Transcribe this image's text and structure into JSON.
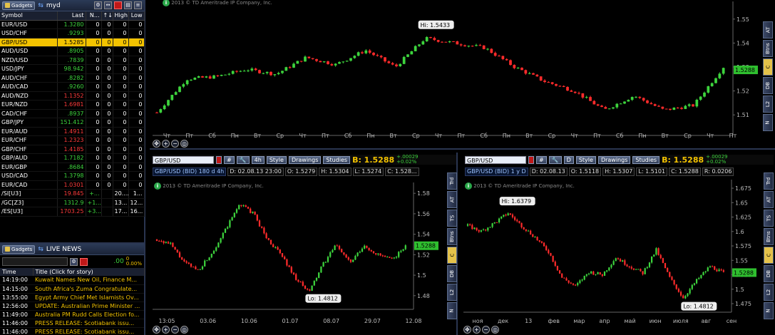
{
  "watchlist": {
    "gadget_label": "Gadgets",
    "name": "myd",
    "columns": [
      "Symbol",
      "Last",
      "N...",
      "↑↓",
      "High",
      "Low"
    ],
    "rows": [
      {
        "sym": "EUR/USD",
        "last": "1.3280",
        "n": "0",
        "a": "0",
        "high": "0",
        "low": "0",
        "dir": "up"
      },
      {
        "sym": "USD/CHF",
        "last": ".9293",
        "n": "0",
        "a": "0",
        "high": "0",
        "low": "0",
        "dir": "up"
      },
      {
        "sym": "GBP/USD",
        "last": "1.5285",
        "n": "0",
        "a": "0",
        "high": "0",
        "low": "0",
        "dir": "up",
        "selected": true
      },
      {
        "sym": "AUD/USD",
        "last": ".8905",
        "n": "0",
        "a": "0",
        "high": "0",
        "low": "0",
        "dir": "up"
      },
      {
        "sym": "NZD/USD",
        "last": ".7839",
        "n": "0",
        "a": "0",
        "high": "0",
        "low": "0",
        "dir": "up"
      },
      {
        "sym": "USD/JPY",
        "last": "98.942",
        "n": "0",
        "a": "0",
        "high": "0",
        "low": "0",
        "dir": "up"
      },
      {
        "sym": "AUD/CHF",
        "last": ".8282",
        "n": "0",
        "a": "0",
        "high": "0",
        "low": "0",
        "dir": "up"
      },
      {
        "sym": "AUD/CAD",
        "last": ".9260",
        "n": "0",
        "a": "0",
        "high": "0",
        "low": "0",
        "dir": "up"
      },
      {
        "sym": "AUD/NZD",
        "last": "1.1352",
        "n": "0",
        "a": "0",
        "high": "0",
        "low": "0",
        "dir": "dn"
      },
      {
        "sym": "EUR/NZD",
        "last": "1.6981",
        "n": "0",
        "a": "0",
        "high": "0",
        "low": "0",
        "dir": "dn"
      },
      {
        "sym": "CAD/CHF",
        "last": ".8937",
        "n": "0",
        "a": "0",
        "high": "0",
        "low": "0",
        "dir": "up"
      },
      {
        "sym": "GBP/JPY",
        "last": "151.412",
        "n": "0",
        "a": "0",
        "high": "0",
        "low": "0",
        "dir": "up"
      },
      {
        "sym": "EUR/AUD",
        "last": "1.4911",
        "n": "0",
        "a": "0",
        "high": "0",
        "low": "0",
        "dir": "dn"
      },
      {
        "sym": "EUR/CHF",
        "last": "1.2323",
        "n": "0",
        "a": "0",
        "high": "0",
        "low": "0",
        "dir": "dn"
      },
      {
        "sym": "GBP/CHF",
        "last": "1.4185",
        "n": "0",
        "a": "0",
        "high": "0",
        "low": "0",
        "dir": "dn"
      },
      {
        "sym": "GBP/AUD",
        "last": "1.7182",
        "n": "0",
        "a": "0",
        "high": "0",
        "low": "0",
        "dir": "up"
      },
      {
        "sym": "EUR/GBP",
        "last": ".8684",
        "n": "0",
        "a": "0",
        "high": "0",
        "low": "0",
        "dir": "up"
      },
      {
        "sym": "USD/CAD",
        "last": "1.3798",
        "n": "0",
        "a": "0",
        "high": "0",
        "low": "0",
        "dir": "up"
      },
      {
        "sym": "EUR/CAD",
        "last": "1.0301",
        "n": "0",
        "a": "0",
        "high": "0",
        "low": "0",
        "dir": "dn"
      },
      {
        "sym": "/SI[U3]",
        "last": "19.845",
        "n": "+...",
        "a": "",
        "high": "20....",
        "low": "1...",
        "dir": "dn"
      },
      {
        "sym": "/GC[Z3]",
        "last": "1312.9",
        "n": "+1...",
        "a": "",
        "high": "13...",
        "low": "12...",
        "dir": "up"
      },
      {
        "sym": "/ES[U3]",
        "last": "1703.25",
        "n": "+3...",
        "a": "",
        "high": "17...",
        "low": "16...",
        "dir": "dn"
      }
    ]
  },
  "news": {
    "gadget_label": "Gadgets",
    "title": "LIVE NEWS",
    "sym_value": ".00",
    "pct_top": "0",
    "pct_bottom": "0.00%",
    "columns": [
      "Time",
      "Title (Click for story)"
    ],
    "rows": [
      {
        "time": "14:19:00",
        "title": "Kuwait Names New Oil, Finance M..."
      },
      {
        "time": "14:15:00",
        "title": "South Africa's Zuma Congratulate..."
      },
      {
        "time": "13:55:00",
        "title": "Egypt Army Chief Met Islamists Ov..."
      },
      {
        "time": "12:56:00",
        "title": "UPDATE: Australian Prime Minister ..."
      },
      {
        "time": "11:49:00",
        "title": "Australia PM Rudd Calls Election fo..."
      },
      {
        "time": "11:46:00",
        "title": "PRESS RELEASE: Scotiabank issu..."
      },
      {
        "time": "11:46:00",
        "title": "PRESS RELEASE: Scotiabank issu..."
      }
    ]
  },
  "top_chart": {
    "copyright": "2013 © TD Ameritrade IP Company, Inc.",
    "hi_label": "Hi: 1.5433",
    "price_tag": "1.5288",
    "y_labels": [
      "1.55",
      "1.54",
      "1.53",
      "1.52",
      "1.51"
    ],
    "x_labels": [
      "Чт",
      "Пт",
      "Сб",
      "Пн",
      "Вт",
      "Ср",
      "Чт",
      "Пт",
      "Сб",
      "Пн",
      "Вт",
      "Ср",
      "Чт",
      "Пт",
      "Сб",
      "Пн",
      "Вт",
      "Ср",
      "Чт",
      "Пт",
      "Сб",
      "Пн",
      "Вт",
      "Ср",
      "Чт",
      "Пт"
    ],
    "side_tabs": [
      "AT",
      "Btns",
      "C",
      "DB",
      "L2",
      "N"
    ]
  },
  "left_chart": {
    "symbol": "GBP/USD",
    "interval": "4h",
    "style_label": "Style",
    "drawings_label": "Drawings",
    "studies_label": "Studies",
    "bid_price": "B: 1.5288",
    "change_top": "+.00029",
    "change_bottom": "+0.02%",
    "info": [
      "GBP/USD (BID) 180 d 4h",
      "D: 02.08.13 23:00",
      "O: 1.5279",
      "H: 1.5304",
      "L: 1.5274",
      "C: 1.528..."
    ],
    "copyright": "2013 © TD Ameritrade IP Company, Inc.",
    "lo_label": "Lo: 1.4812",
    "price_tag": "1.5288",
    "y_labels": [
      "1.58",
      "1.56",
      "1.54",
      "1.52",
      "1.5",
      "1.48"
    ],
    "x_labels": [
      "13:05",
      "03.06",
      "10.06",
      "01.07",
      "08.07",
      "29.07",
      "12.08"
    ],
    "side_tabs": [
      "Trd",
      "AT",
      "TS",
      "Btns",
      "C",
      "DB",
      "L2",
      "N"
    ]
  },
  "right_chart": {
    "symbol": "GBP/USD",
    "interval": "D",
    "style_label": "Style",
    "drawings_label": "Drawings",
    "studies_label": "Studies",
    "bid_price": "B: 1.5288",
    "change_top": "+.00029",
    "change_bottom": "+0.02%",
    "info": [
      "GBP/USD (BID) 1 y D",
      "D: 02.08.13",
      "O: 1.5118",
      "H: 1.5307",
      "L: 1.5101",
      "C: 1.5288",
      "R: 0.0206"
    ],
    "copyright": "2013 © TD Ameritrade IP Company, Inc.",
    "hi_label": "Hi: 1.6379",
    "lo_label": "Lo: 1.4812",
    "price_tag": "1.5288",
    "y_labels": [
      "1.675",
      "1.65",
      "1.625",
      "1.6",
      "1.575",
      "1.55",
      "1.525",
      "1.5",
      "1.475"
    ],
    "x_labels": [
      "ноя",
      "дек",
      "13",
      "фев",
      "мар",
      "апр",
      "май",
      "июн",
      "июля",
      "авг",
      "сен"
    ],
    "side_tabs": [
      "Trd",
      "AT",
      "TS",
      "Btns",
      "C",
      "DB",
      "L2",
      "N"
    ]
  },
  "colors": {
    "up": "#3dd43d",
    "down": "#ff3b3b",
    "accent": "#f3c300",
    "panel": "#2a3550"
  }
}
